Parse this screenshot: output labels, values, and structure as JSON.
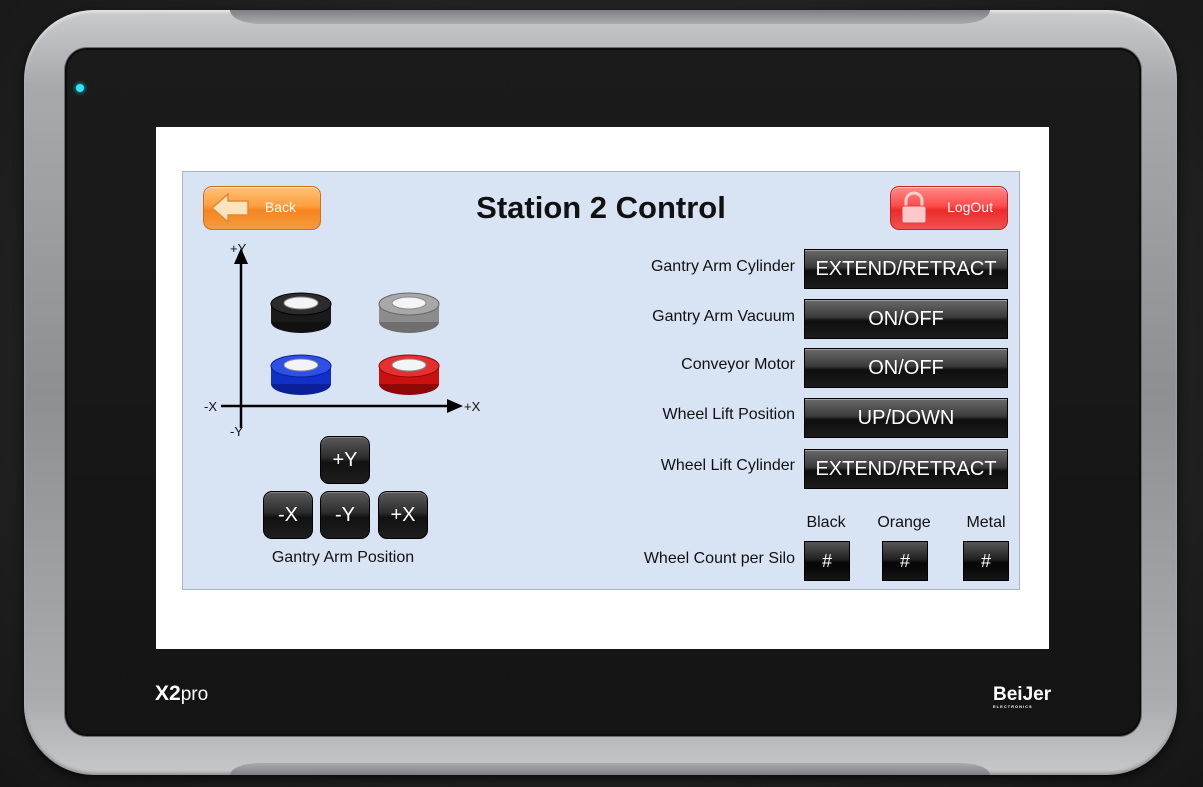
{
  "header": {
    "title": "Station 2 Control",
    "back_label": "Back",
    "logout_label": "LogOut"
  },
  "gantry": {
    "axes": {
      "plus_y": "+Y",
      "minus_y": "-Y",
      "plus_x": "+X",
      "minus_x": "-X"
    },
    "wheels": [
      {
        "name": "black-wheel",
        "color": "#1a1a1a"
      },
      {
        "name": "gray-wheel",
        "color": "#8c8c8c"
      },
      {
        "name": "blue-wheel",
        "color": "#1030c8"
      },
      {
        "name": "red-wheel",
        "color": "#cc1010"
      }
    ],
    "jog_buttons": {
      "plus_y": "+Y",
      "minus_x": "-X",
      "minus_y": "-Y",
      "plus_x": "+X"
    },
    "label": "Gantry Arm Position"
  },
  "controls": [
    {
      "label": "Gantry Arm Cylinder",
      "button": "EXTEND/RETRACT"
    },
    {
      "label": "Gantry Arm Vacuum",
      "button": "ON/OFF"
    },
    {
      "label": "Conveyor Motor",
      "button": "ON/OFF"
    },
    {
      "label": "Wheel Lift Position",
      "button": "UP/DOWN"
    },
    {
      "label": "Wheel Lift Cylinder",
      "button": "EXTEND/RETRACT"
    }
  ],
  "silo_counts": {
    "label": "Wheel Count per Silo",
    "columns": [
      {
        "name": "Black",
        "value": "#"
      },
      {
        "name": "Orange",
        "value": "#"
      },
      {
        "name": "Metal",
        "value": "#"
      }
    ]
  },
  "device": {
    "model_x2": "X2",
    "model_pro": "pro",
    "maker": "BeiJer",
    "maker_sub": "ELECTRONICS",
    "led_color": "#2ee6ff"
  }
}
